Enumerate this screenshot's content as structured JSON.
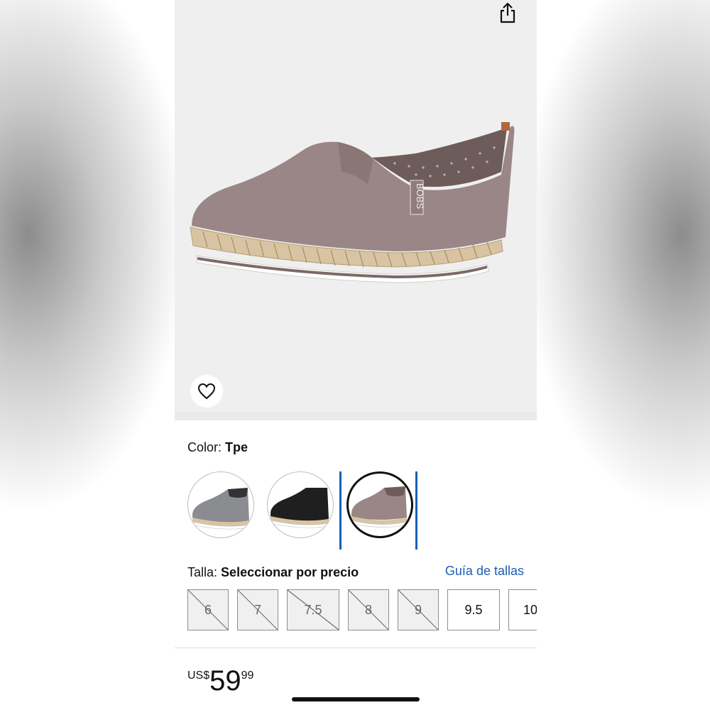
{
  "product": {
    "color_label": "Color:",
    "color_value": "Tpe",
    "image_alt": "Bobs taupe espadrille slip-on shoe"
  },
  "icons": {
    "share": "share-icon",
    "favorite": "heart-icon"
  },
  "swatches": [
    {
      "name": "gray",
      "color": "#8a8c8f",
      "selected": false
    },
    {
      "name": "black",
      "color": "#1f1f1f",
      "selected": false
    },
    {
      "name": "taupe",
      "color": "#9a8686",
      "selected": true
    }
  ],
  "size": {
    "label": "Talla:",
    "value": "Seleccionar por precio",
    "guide_link": "Guía de tallas",
    "options": [
      {
        "label": "6",
        "available": false
      },
      {
        "label": "7",
        "available": false
      },
      {
        "label": "7.5",
        "available": false
      },
      {
        "label": "8",
        "available": false
      },
      {
        "label": "9",
        "available": false
      },
      {
        "label": "9.5",
        "available": true
      },
      {
        "label": "10",
        "available": true
      }
    ]
  },
  "price": {
    "currency": "US$",
    "whole": "59",
    "fraction": "99"
  },
  "colors": {
    "link": "#1a5fb4",
    "selected_frame": "#1a5fb4"
  }
}
